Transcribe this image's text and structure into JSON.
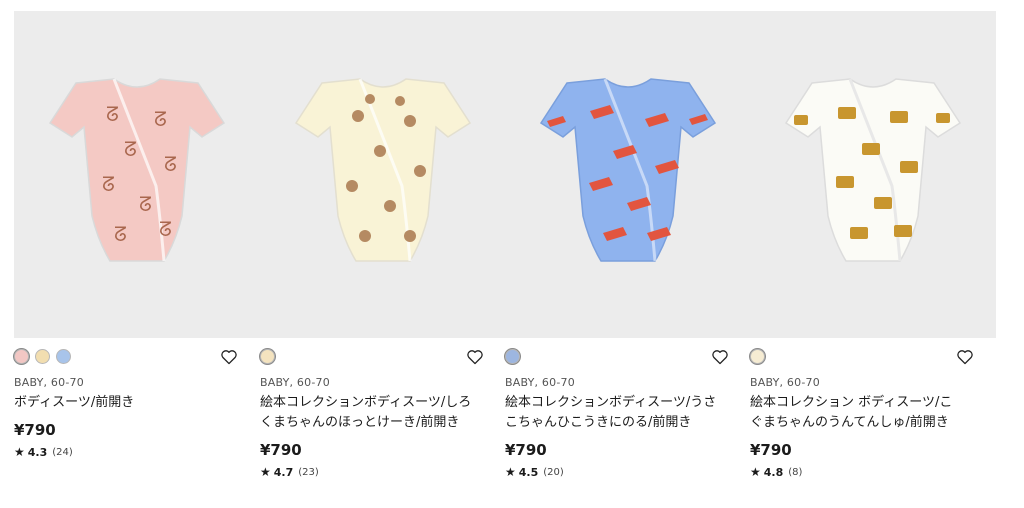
{
  "products": [
    {
      "category": "BABY, 60-70",
      "name": "ボディスーツ/前開き",
      "price": "¥790",
      "rating": "4.3",
      "reviews": "(24)",
      "body_color": "#f4c9c4",
      "print_color": "#a9674e",
      "swatch_colors": [
        "#f2c7c4",
        "#f2deb0",
        "#a8c4ea"
      ],
      "icons": {
        "favorite": "heart-outline-icon",
        "rating": "star-icon"
      }
    },
    {
      "category": "BABY, 60-70",
      "name": "絵本コレクションボディスーツ/しろくまちゃんのほっとけーき/前開き",
      "price": "¥790",
      "rating": "4.7",
      "reviews": "(23)",
      "body_color": "#f9f3d6",
      "print_color": "#b58a62",
      "swatch_colors": [
        "#f4e3bf"
      ],
      "icons": {
        "favorite": "heart-outline-icon",
        "rating": "star-icon"
      }
    },
    {
      "category": "BABY, 60-70",
      "name": "絵本コレクションボディスーツ/うさこちゃんひこうきにのる/前開き",
      "price": "¥790",
      "rating": "4.5",
      "reviews": "(20)",
      "body_color": "#8fb3ee",
      "print_color": "#e2553f",
      "swatch_colors": [
        "#9db6e0"
      ],
      "icons": {
        "favorite": "heart-outline-icon",
        "rating": "star-icon"
      }
    },
    {
      "category": "BABY, 60-70",
      "name": "絵本コレクション ボディスーツ/こぐまちゃんのうんてんしゅ/前開き",
      "price": "¥790",
      "rating": "4.8",
      "reviews": "(8)",
      "body_color": "#fbfbf6",
      "print_color": "#c8962f",
      "swatch_colors": [
        "#f6ecd3"
      ],
      "icons": {
        "favorite": "heart-outline-icon",
        "rating": "star-icon"
      }
    }
  ]
}
